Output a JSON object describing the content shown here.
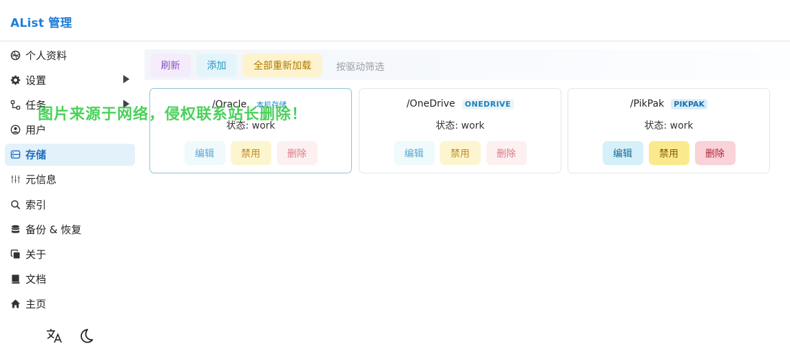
{
  "app": {
    "title": "AList 管理"
  },
  "sidebar": {
    "items": [
      {
        "label": "个人资料",
        "icon": "palette-icon"
      },
      {
        "label": "设置",
        "icon": "gear-icon",
        "expandable": true
      },
      {
        "label": "任务",
        "icon": "flow-icon",
        "expandable": true
      },
      {
        "label": "用户",
        "icon": "user-circle-icon"
      },
      {
        "label": "存储",
        "icon": "storage-icon",
        "active": true
      },
      {
        "label": "元信息",
        "icon": "meta-icon"
      },
      {
        "label": "索引",
        "icon": "search-icon"
      },
      {
        "label": "备份 & 恢复",
        "icon": "database-icon"
      },
      {
        "label": "关于",
        "icon": "copy-icon"
      },
      {
        "label": "文档",
        "icon": "book-icon"
      },
      {
        "label": "主页",
        "icon": "home-icon"
      }
    ]
  },
  "toolbar": {
    "refresh_label": "刷新",
    "add_label": "添加",
    "reload_all_label": "全部重新加载",
    "filter_label": "按驱动筛选"
  },
  "storages": [
    {
      "mount_path": "/Oracle",
      "driver": "本机存储",
      "status": "状态: work",
      "edit": "编辑",
      "disable": "禁用",
      "delete": "删除"
    },
    {
      "mount_path": "/OneDrive",
      "driver": "ONEDRIVE",
      "status": "状态: work",
      "edit": "编辑",
      "disable": "禁用",
      "delete": "删除"
    },
    {
      "mount_path": "/PikPak",
      "driver": "PIKPAK",
      "status": "状态: work",
      "edit": "编辑",
      "disable": "禁用",
      "delete": "删除"
    }
  ],
  "watermark": "图片来源于网络，侵权联系站长删除！",
  "colors": {
    "accent": "#1f7ed8",
    "active_bg": "#e3f1fb",
    "watermark": "#22c736"
  }
}
